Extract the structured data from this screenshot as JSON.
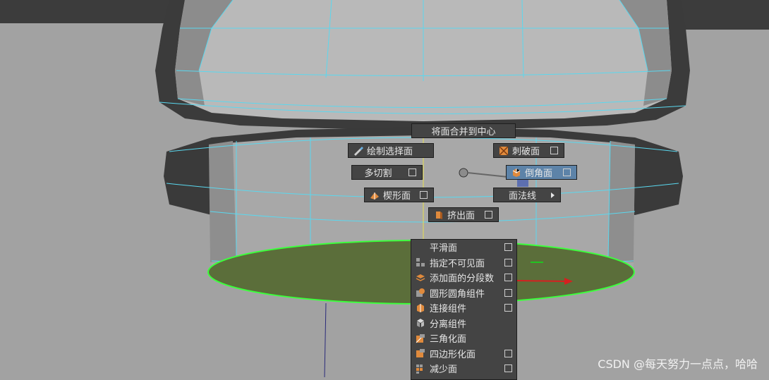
{
  "marking_menu": {
    "north": "将面合并到中心",
    "north_west": "绘制选择面",
    "north_east": "刺破面",
    "west": "多切割",
    "east": "倒角面",
    "south_west": "楔形面",
    "south_east": "面法线",
    "south": "挤出面"
  },
  "overflow_menu": {
    "items": [
      {
        "label": "平滑面",
        "has_option": true
      },
      {
        "label": "指定不可见面",
        "has_option": true
      },
      {
        "label": "添加面的分段数",
        "has_option": true
      },
      {
        "label": "圆形圆角组件",
        "has_option": true
      },
      {
        "label": "连接组件",
        "has_option": true
      },
      {
        "label": "分离组件",
        "has_option": false
      },
      {
        "label": "三角化面",
        "has_option": false
      },
      {
        "label": "四边形化面",
        "has_option": true
      },
      {
        "label": "减少面",
        "has_option": true
      }
    ]
  },
  "watermark": "CSDN @每天努力一点点，哈哈",
  "colors": {
    "viewport_bg": "#a2a2a2",
    "wireframe": "#5ad8ef",
    "selected_face": "#5b6e3a",
    "selection_outline": "#3cff3c",
    "menu_bg": "#444444",
    "highlight": "#5d83a8",
    "icon_orange": "#e08a3c"
  }
}
